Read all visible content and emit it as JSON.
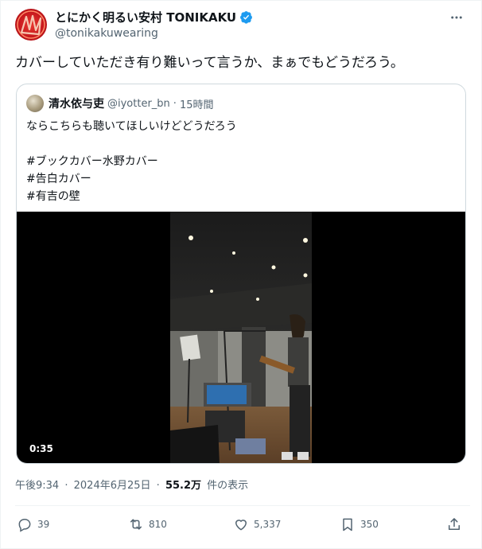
{
  "author": {
    "display_name": "とにかく明るい安村 TONIKAKU",
    "handle": "@tonikakuwearing",
    "verified_icon": "verified-badge-icon"
  },
  "tweet": {
    "text": "カバーしていただき有り難いって言うか、まぁでもどうだろう。"
  },
  "quote": {
    "display_name": "清水依与吏",
    "handle": "@iyotter_bn",
    "separator": "·",
    "time_ago": "15時間",
    "text": "ならこちらも聴いてほしいけどどうだろう\n\n#ブックカバー水野カバー\n#告白カバー\n#有吉の壁",
    "video_duration": "0:35"
  },
  "meta": {
    "time": "午後9:34",
    "sep1": "·",
    "date": "2024年6月25日",
    "sep2": "·",
    "views_count": "55.2万",
    "views_label": "件の表示"
  },
  "actions": {
    "replies": "39",
    "retweets": "810",
    "likes": "5,337",
    "bookmarks": "350"
  },
  "colors": {
    "accent": "#1d9bf0",
    "secondary_text": "#536471",
    "border": "#cfd9de"
  }
}
